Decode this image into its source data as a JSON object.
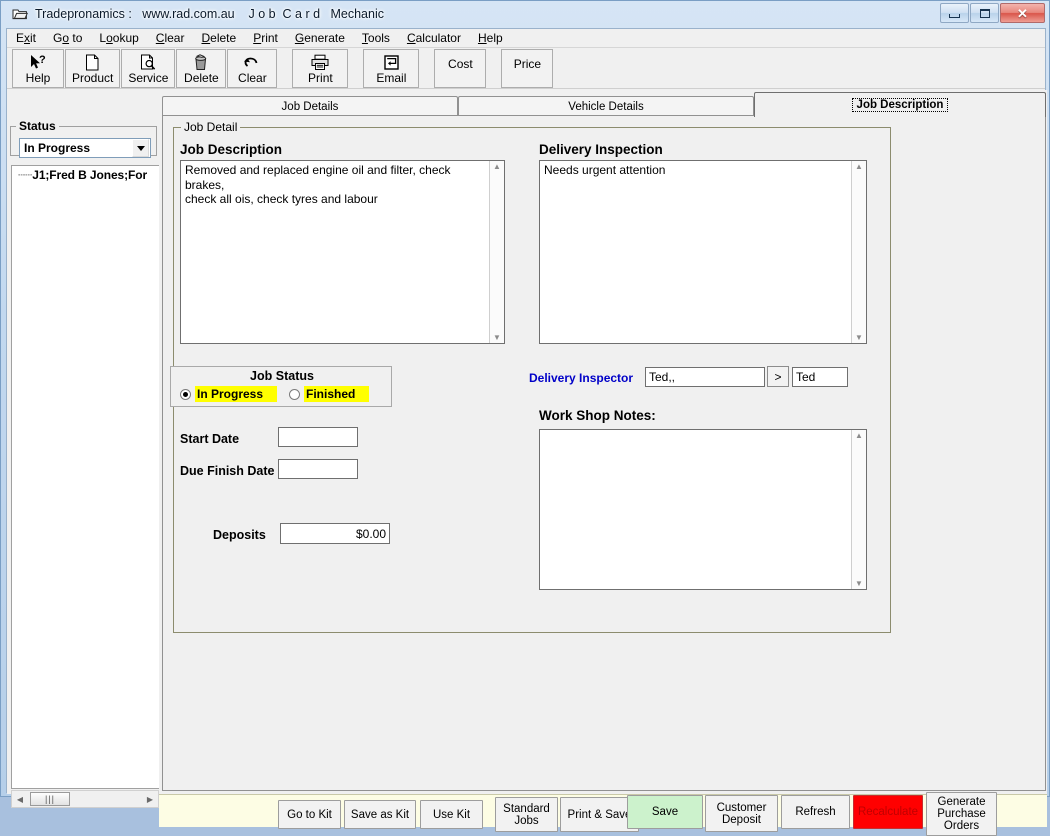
{
  "window": {
    "title": "Tradepronamics :   www.rad.com.au    J o b  C a r d   Mechanic",
    "icon": "window-app-icon",
    "minimize_label": "Minimize",
    "maximize_label": "Maximize",
    "close_label": "Close"
  },
  "menubar": {
    "items": [
      {
        "pre": "E",
        "accel": "x",
        "post": "it"
      },
      {
        "pre": "G",
        "accel": "o",
        "post": " to"
      },
      {
        "pre": "L",
        "accel": "o",
        "post": "okup"
      },
      {
        "pre": "",
        "accel": "C",
        "post": "lear"
      },
      {
        "pre": "",
        "accel": "D",
        "post": "elete"
      },
      {
        "pre": "",
        "accel": "P",
        "post": "rint"
      },
      {
        "pre": "",
        "accel": "G",
        "post": "enerate"
      },
      {
        "pre": "",
        "accel": "T",
        "post": "ools"
      },
      {
        "pre": "",
        "accel": "C",
        "post": "alculator"
      },
      {
        "pre": "",
        "accel": "H",
        "post": "elp"
      }
    ]
  },
  "toolbar": {
    "buttons": [
      {
        "label": "Help",
        "icon": "help-arrow-question-icon"
      },
      {
        "label": "Product",
        "icon": "page-icon"
      },
      {
        "label": "Service",
        "icon": "page-search-icon"
      },
      {
        "label": "Delete",
        "icon": "trash-can-icon"
      },
      {
        "label": "Clear",
        "icon": "undo-arrow-icon"
      },
      {
        "label": "Print",
        "icon": "printer-icon"
      },
      {
        "label": "Email",
        "icon": "email-tray-icon"
      },
      {
        "label": "Cost",
        "icon": ""
      },
      {
        "label": "Price",
        "icon": ""
      }
    ]
  },
  "sidebar": {
    "status_legend": "Status",
    "status_value": "In Progress",
    "status_arrow_icon": "chevron-down-icon",
    "tree_items": [
      "J1;Fred B Jones;For"
    ],
    "hscroll_left_icon": "scroll-left-icon",
    "hscroll_right_icon": "scroll-right-icon"
  },
  "tabs": [
    {
      "label": "Job Details",
      "active": false
    },
    {
      "label": "Vehicle Details",
      "active": false
    },
    {
      "label": "Job Description",
      "active": true
    }
  ],
  "job_detail": {
    "group_legend": "Job Detail",
    "job_description": {
      "heading": "Job Description",
      "value": "Removed and replaced engine oil and filter, check brakes,\ncheck all ois, check tyres and labour"
    },
    "delivery_inspection": {
      "heading": "Delivery Inspection",
      "value": "Needs urgent attention"
    },
    "job_status": {
      "title": "Job Status",
      "options": [
        {
          "label": "In Progress",
          "selected": true
        },
        {
          "label": "Finished",
          "selected": false
        }
      ]
    },
    "start_date": {
      "label": "Start Date",
      "value": ""
    },
    "due_finish_date": {
      "label": "Due Finish Date",
      "value": ""
    },
    "deposits": {
      "label": "Deposits",
      "value": "$0.00"
    },
    "delivery_inspector": {
      "label": "Delivery Inspector",
      "value": "Ted,,",
      "button_label": ">",
      "code_value": "Ted"
    },
    "work_shop_notes": {
      "heading": "Work Shop Notes:",
      "value": ""
    }
  },
  "bottom_bar": {
    "buttons": [
      {
        "label": "Go to Kit"
      },
      {
        "label": "Save as Kit"
      },
      {
        "label": "Use Kit"
      },
      {
        "label": "Standard\nJobs"
      },
      {
        "label": "Print & Save"
      },
      {
        "label": "Save"
      },
      {
        "label": "Customer\nDeposit"
      },
      {
        "label": "Refresh"
      },
      {
        "label": "Recalculate"
      },
      {
        "label": "Generate\nPurchase\nOrders"
      }
    ]
  },
  "colors": {
    "highlight_yellow": "#ffff00",
    "save_green": "#ccf2cc",
    "recalculate_red": "#ff0000",
    "inspector_blue": "#0000c8",
    "bottom_bar_cream": "#fdfde4"
  }
}
